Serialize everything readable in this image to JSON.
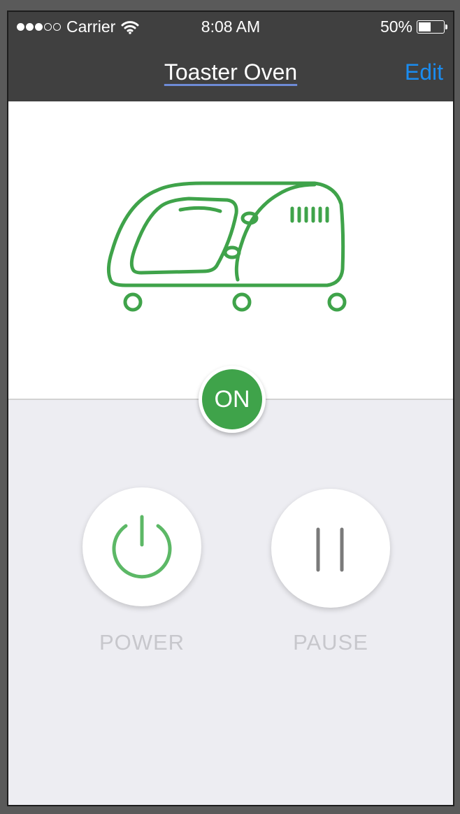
{
  "status_bar": {
    "carrier": "Carrier",
    "signal_bars_filled": 3,
    "signal_bars_total": 5,
    "time": "8:08 AM",
    "battery_text": "50%",
    "battery_level": 0.5
  },
  "nav": {
    "title": "Toaster Oven",
    "edit_label": "Edit"
  },
  "device": {
    "icon": "toaster-oven-icon",
    "state_label": "ON"
  },
  "controls": {
    "power_label": "POWER",
    "power_icon": "power-icon",
    "pause_label": "PAUSE",
    "pause_icon": "pause-icon"
  },
  "colors": {
    "accent_green": "#3fa34a",
    "edit_blue": "#1a8cf0",
    "header_bg": "#404040"
  }
}
